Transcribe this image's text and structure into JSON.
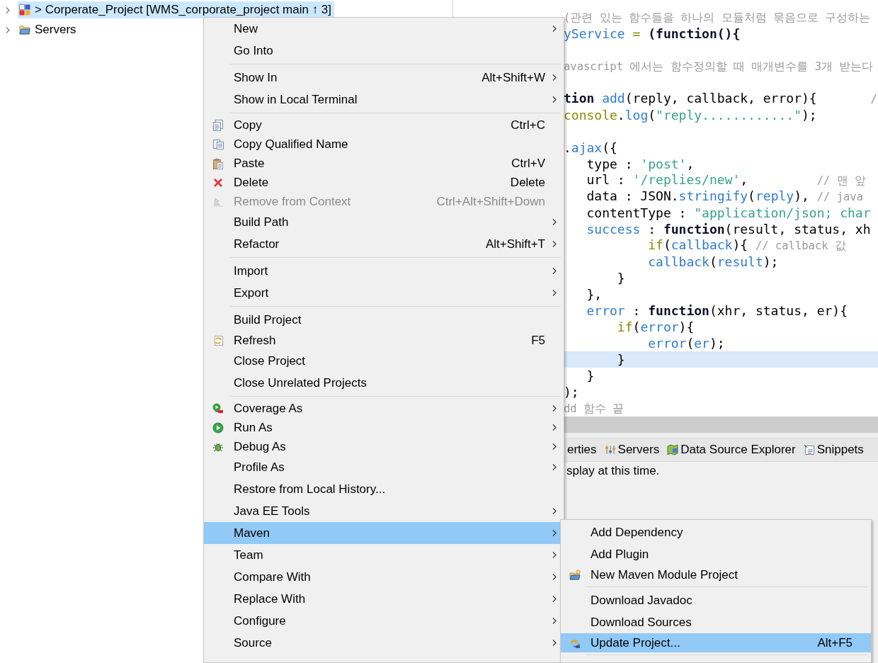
{
  "project_explorer": {
    "items": [
      {
        "label": "> Corperate_Project [WMS_corporate_project main ↑ 3]",
        "selected": true
      },
      {
        "label": "Servers",
        "selected": false
      }
    ]
  },
  "editor": {
    "lines": [
      {
        "kind": "blank",
        "current": false
      },
      {
        "kind": "code",
        "current": false,
        "tokens": [
          {
            "kind": "comment",
            "text": "(관련 있는 함수들을 하나의 모듈처럼 묶음으로 구성하는"
          }
        ]
      },
      {
        "kind": "code",
        "current": false,
        "tokens": [
          {
            "kind": "ident",
            "text": "yService"
          },
          {
            "kind": "olive",
            "text": " = "
          },
          {
            "kind": "keyword",
            "text": "(function(){"
          }
        ]
      },
      {
        "kind": "blank",
        "current": false
      },
      {
        "kind": "code",
        "current": false,
        "tokens": [
          {
            "kind": "comment",
            "text": "avascript 에서는 함수정의할 때 매개변수를 3개 받는다"
          }
        ]
      },
      {
        "kind": "blank",
        "current": false
      },
      {
        "kind": "code",
        "current": false,
        "tokens": [
          {
            "kind": "keyword",
            "text": "tion"
          },
          {
            "kind": "ident",
            "text": " add"
          },
          {
            "kind": "plain",
            "text": "(reply, callback, error){       "
          },
          {
            "kind": "comment",
            "text": "/"
          }
        ]
      },
      {
        "kind": "code",
        "current": false,
        "tokens": [
          {
            "kind": "olive",
            "text": "console"
          },
          {
            "kind": "plain",
            "text": "."
          },
          {
            "kind": "ident",
            "text": "log"
          },
          {
            "kind": "plain",
            "text": "("
          },
          {
            "kind": "string",
            "text": "\"reply............\""
          },
          {
            "kind": "plain",
            "text": ");"
          }
        ]
      },
      {
        "kind": "blank",
        "current": false
      },
      {
        "kind": "code",
        "current": false,
        "tokens": [
          {
            "kind": "plain",
            "text": "."
          },
          {
            "kind": "ident",
            "text": "ajax"
          },
          {
            "kind": "plain",
            "text": "({"
          }
        ]
      },
      {
        "kind": "code",
        "current": false,
        "tokens": [
          {
            "kind": "plain",
            "text": "   type : "
          },
          {
            "kind": "string",
            "text": "'post'"
          },
          {
            "kind": "plain",
            "text": ","
          }
        ]
      },
      {
        "kind": "code",
        "current": false,
        "tokens": [
          {
            "kind": "plain",
            "text": "   url : "
          },
          {
            "kind": "string",
            "text": "'/replies/new'"
          },
          {
            "kind": "plain",
            "text": ",         "
          },
          {
            "kind": "comment",
            "text": "// 맨 앞"
          }
        ]
      },
      {
        "kind": "code",
        "current": false,
        "tokens": [
          {
            "kind": "plain",
            "text": "   data : JSON."
          },
          {
            "kind": "ident",
            "text": "stringify"
          },
          {
            "kind": "plain",
            "text": "("
          },
          {
            "kind": "ident",
            "text": "reply"
          },
          {
            "kind": "plain",
            "text": "), "
          },
          {
            "kind": "comment",
            "text": "// java"
          }
        ]
      },
      {
        "kind": "code",
        "current": false,
        "tokens": [
          {
            "kind": "plain",
            "text": "   contentType : "
          },
          {
            "kind": "string",
            "text": "\"application/json; char"
          }
        ]
      },
      {
        "kind": "code",
        "current": false,
        "tokens": [
          {
            "kind": "ident",
            "text": "   success"
          },
          {
            "kind": "plain",
            "text": " : "
          },
          {
            "kind": "keyword",
            "text": "function"
          },
          {
            "kind": "plain",
            "text": "(result, status, xh"
          }
        ]
      },
      {
        "kind": "code",
        "current": false,
        "tokens": [
          {
            "kind": "olive",
            "text": "           if"
          },
          {
            "kind": "plain",
            "text": "("
          },
          {
            "kind": "ident",
            "text": "callback"
          },
          {
            "kind": "plain",
            "text": "){ "
          },
          {
            "kind": "comment",
            "text": "// callback 값"
          }
        ]
      },
      {
        "kind": "code",
        "current": false,
        "tokens": [
          {
            "kind": "ident",
            "text": "           callback"
          },
          {
            "kind": "plain",
            "text": "("
          },
          {
            "kind": "ident",
            "text": "result"
          },
          {
            "kind": "plain",
            "text": ");"
          }
        ]
      },
      {
        "kind": "code",
        "current": false,
        "tokens": [
          {
            "kind": "plain",
            "text": "       }"
          }
        ]
      },
      {
        "kind": "code",
        "current": false,
        "tokens": [
          {
            "kind": "plain",
            "text": "   },"
          }
        ]
      },
      {
        "kind": "code",
        "current": false,
        "tokens": [
          {
            "kind": "ident",
            "text": "   error"
          },
          {
            "kind": "plain",
            "text": " : "
          },
          {
            "kind": "keyword",
            "text": "function"
          },
          {
            "kind": "plain",
            "text": "(xhr, status, er){"
          }
        ]
      },
      {
        "kind": "code",
        "current": false,
        "tokens": [
          {
            "kind": "olive",
            "text": "       if"
          },
          {
            "kind": "plain",
            "text": "("
          },
          {
            "kind": "ident",
            "text": "error"
          },
          {
            "kind": "plain",
            "text": "){"
          }
        ]
      },
      {
        "kind": "code",
        "current": false,
        "tokens": [
          {
            "kind": "ident",
            "text": "           error"
          },
          {
            "kind": "plain",
            "text": "("
          },
          {
            "kind": "ident",
            "text": "er"
          },
          {
            "kind": "plain",
            "text": ");"
          }
        ]
      },
      {
        "kind": "code",
        "current": true,
        "tokens": [
          {
            "kind": "plain",
            "text": "       }"
          }
        ]
      },
      {
        "kind": "code",
        "current": false,
        "tokens": [
          {
            "kind": "plain",
            "text": "   }"
          }
        ]
      },
      {
        "kind": "code",
        "current": false,
        "tokens": [
          {
            "kind": "plain",
            "text": ");"
          }
        ]
      },
      {
        "kind": "code",
        "current": false,
        "tokens": [
          {
            "kind": "comment",
            "text": "dd 함수 끝"
          }
        ]
      }
    ]
  },
  "bottom_panel": {
    "tabs": [
      {
        "label": "erties",
        "selected": false
      },
      {
        "label": "Servers",
        "selected": false
      },
      {
        "label": "Data Source Explorer",
        "selected": false
      },
      {
        "label": "Snippets",
        "selected": false
      }
    ],
    "message": "splay at this time."
  },
  "context_menu": {
    "items": [
      {
        "kind": "item",
        "label": "New",
        "submenu": true,
        "disabled": false,
        "selected": false
      },
      {
        "kind": "item",
        "label": "Go Into",
        "submenu": false,
        "disabled": false,
        "selected": false
      },
      {
        "kind": "separator"
      },
      {
        "kind": "item",
        "label": "Show In",
        "shortcut": "Alt+Shift+W",
        "submenu": true,
        "disabled": false,
        "selected": false
      },
      {
        "kind": "item",
        "label": "Show in Local Terminal",
        "submenu": true,
        "disabled": false,
        "selected": false
      },
      {
        "kind": "separator"
      },
      {
        "kind": "item",
        "label": "Copy",
        "shortcut": "Ctrl+C",
        "submenu": false,
        "disabled": false,
        "selected": false
      },
      {
        "kind": "item",
        "label": "Copy Qualified Name",
        "submenu": false,
        "disabled": false,
        "selected": false
      },
      {
        "kind": "item",
        "label": "Paste",
        "shortcut": "Ctrl+V",
        "submenu": false,
        "disabled": false,
        "selected": false
      },
      {
        "kind": "item",
        "label": "Delete",
        "shortcut": "Delete",
        "submenu": false,
        "disabled": false,
        "selected": false
      },
      {
        "kind": "item",
        "label": "Remove from Context",
        "shortcut": "Ctrl+Alt+Shift+Down",
        "submenu": false,
        "disabled": true,
        "selected": false
      },
      {
        "kind": "item",
        "label": "Build Path",
        "submenu": true,
        "disabled": false,
        "selected": false
      },
      {
        "kind": "item",
        "label": "Refactor",
        "shortcut": "Alt+Shift+T",
        "submenu": true,
        "disabled": false,
        "selected": false
      },
      {
        "kind": "separator"
      },
      {
        "kind": "item",
        "label": "Import",
        "submenu": true,
        "disabled": false,
        "selected": false
      },
      {
        "kind": "item",
        "label": "Export",
        "submenu": true,
        "disabled": false,
        "selected": false
      },
      {
        "kind": "separator"
      },
      {
        "kind": "item",
        "label": "Build Project",
        "submenu": false,
        "disabled": false,
        "selected": false
      },
      {
        "kind": "item",
        "label": "Refresh",
        "shortcut": "F5",
        "submenu": false,
        "disabled": false,
        "selected": false
      },
      {
        "kind": "item",
        "label": "Close Project",
        "submenu": false,
        "disabled": false,
        "selected": false
      },
      {
        "kind": "item",
        "label": "Close Unrelated Projects",
        "submenu": false,
        "disabled": false,
        "selected": false
      },
      {
        "kind": "separator"
      },
      {
        "kind": "item",
        "label": "Coverage As",
        "submenu": true,
        "disabled": false,
        "selected": false
      },
      {
        "kind": "item",
        "label": "Run As",
        "submenu": true,
        "disabled": false,
        "selected": false
      },
      {
        "kind": "item",
        "label": "Debug As",
        "submenu": true,
        "disabled": false,
        "selected": false
      },
      {
        "kind": "item",
        "label": "Profile As",
        "submenu": true,
        "disabled": false,
        "selected": false
      },
      {
        "kind": "item",
        "label": "Restore from Local History...",
        "submenu": false,
        "disabled": false,
        "selected": false
      },
      {
        "kind": "item",
        "label": "Java EE Tools",
        "submenu": true,
        "disabled": false,
        "selected": false
      },
      {
        "kind": "item",
        "label": "Maven",
        "submenu": true,
        "disabled": false,
        "selected": true
      },
      {
        "kind": "item",
        "label": "Team",
        "submenu": true,
        "disabled": false,
        "selected": false
      },
      {
        "kind": "item",
        "label": "Compare With",
        "submenu": true,
        "disabled": false,
        "selected": false
      },
      {
        "kind": "item",
        "label": "Replace With",
        "submenu": true,
        "disabled": false,
        "selected": false
      },
      {
        "kind": "item",
        "label": "Configure",
        "submenu": true,
        "disabled": false,
        "selected": false
      },
      {
        "kind": "item",
        "label": "Source",
        "submenu": true,
        "disabled": false,
        "selected": false
      }
    ]
  },
  "submenu": {
    "items": [
      {
        "kind": "item",
        "label": "Add Dependency",
        "disabled": false,
        "selected": false
      },
      {
        "kind": "item",
        "label": "Add Plugin",
        "disabled": false,
        "selected": false
      },
      {
        "kind": "item",
        "label": "New Maven Module Project",
        "disabled": false,
        "selected": false
      },
      {
        "kind": "separator"
      },
      {
        "kind": "item",
        "label": "Download Javadoc",
        "disabled": false,
        "selected": false
      },
      {
        "kind": "item",
        "label": "Download Sources",
        "disabled": false,
        "selected": false
      },
      {
        "kind": "item",
        "label": "Update Project...",
        "shortcut": "Alt+F5",
        "disabled": false,
        "selected": true
      },
      {
        "kind": "separator"
      }
    ]
  }
}
